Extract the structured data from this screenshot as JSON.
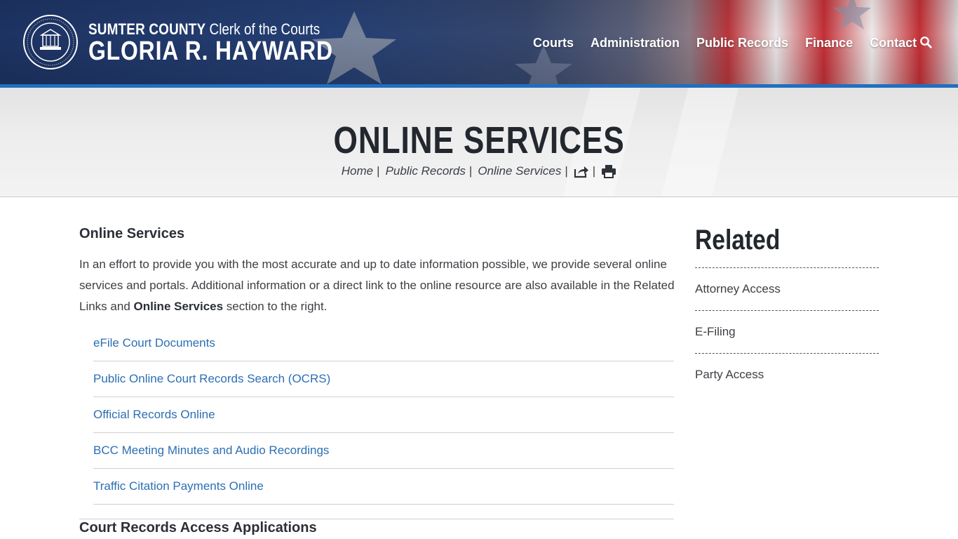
{
  "header": {
    "county": "SUMTER COUNTY",
    "clerk_title": "Clerk of the Courts",
    "name": "GLORIA R. HAYWARD",
    "seal_icon": "county-seal-logo",
    "seal_text": "CLERK OF CIRCUIT & COUNTY COURT · SUMTER COUNTY, FLORIDA",
    "nav": [
      {
        "label": "Courts"
      },
      {
        "label": "Administration"
      },
      {
        "label": "Public Records"
      },
      {
        "label": "Finance"
      },
      {
        "label": "Contact"
      }
    ],
    "search_icon": "search-icon",
    "accent_color": "#1f6fc0"
  },
  "page": {
    "title": "ONLINE SERVICES",
    "breadcrumb": [
      {
        "label": "Home"
      },
      {
        "label": "Public Records"
      },
      {
        "label": "Online Services"
      }
    ],
    "separator": "|",
    "share_icon": "share-icon",
    "print_icon": "print-icon"
  },
  "content": {
    "heading": "Online Services",
    "intro_before": "In an effort to provide you with the most accurate and up to date information possible, we provide several online services and portals.  Additional information or a direct link to the online resource are also available in the Related Links and ",
    "intro_bold": "Online Services",
    "intro_after": " section to the right.",
    "links": [
      {
        "label": "eFile Court Documents"
      },
      {
        "label": "Public Online Court Records Search (OCRS)"
      },
      {
        "label": "Official Records Online"
      },
      {
        "label": "BCC Meeting Minutes and Audio Recordings"
      },
      {
        "label": "Traffic Citation Payments Online"
      }
    ],
    "link_color": "#2c6fb3",
    "subheading": "Court Records Access Applications"
  },
  "sidebar": {
    "title": "Related",
    "items": [
      {
        "label": "Attorney Access"
      },
      {
        "label": "E-Filing"
      },
      {
        "label": "Party Access"
      }
    ]
  }
}
